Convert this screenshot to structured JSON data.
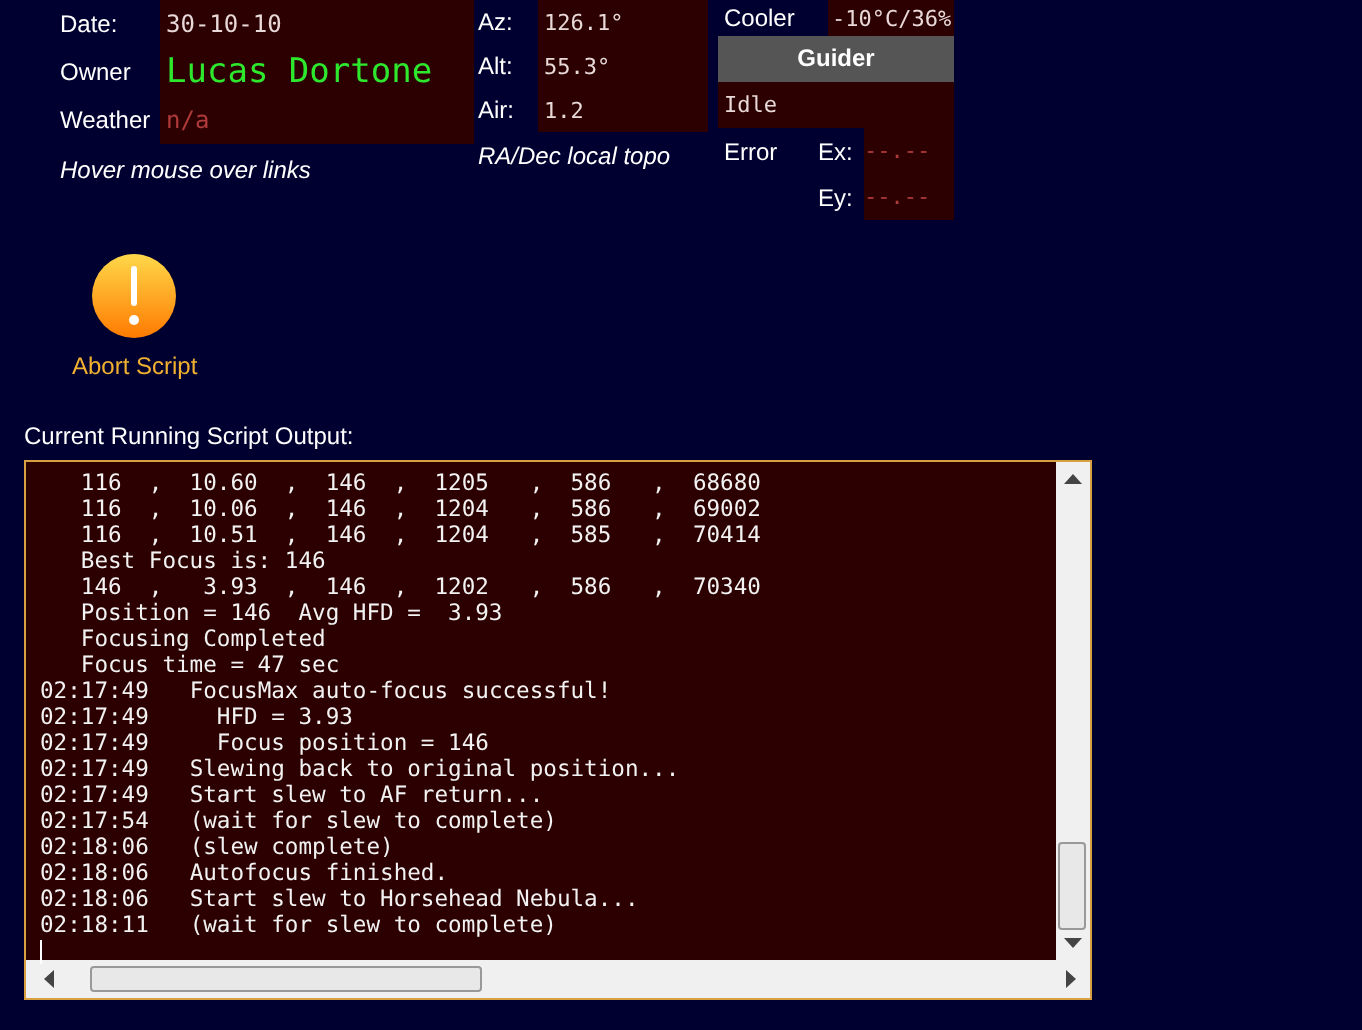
{
  "session": {
    "fields": [
      {
        "label": "Date:",
        "value": "30-10-10",
        "kind": "plain"
      },
      {
        "label": "Owner",
        "value": "Lucas Dortone",
        "kind": "highlight"
      },
      {
        "label": "Weather",
        "value": "n/a",
        "kind": "dim"
      }
    ],
    "hint": "Hover mouse over links"
  },
  "mount": {
    "fields": [
      {
        "label": "Az:",
        "value": "126.1°"
      },
      {
        "label": "Alt:",
        "value": "55.3°"
      },
      {
        "label": "Air:",
        "value": "1.2"
      }
    ],
    "note": "RA/Dec local topo"
  },
  "camera": {
    "cooler_label": "Cooler",
    "cooler_value": "-10°C/36%",
    "guider_title": "Guider",
    "guider_status": "Idle",
    "error_label": "Error",
    "errors": [
      {
        "label": "Ex:",
        "value": "--.--"
      },
      {
        "label": "Ey:",
        "value": "--.--"
      }
    ]
  },
  "abort_button": {
    "label": "Abort Script"
  },
  "output": {
    "title": "Current Running Script Output:",
    "lines": [
      {
        "kind": "detail",
        "text": "116  ,  10.60  ,  146  ,  1205   ,  586   ,  68680"
      },
      {
        "kind": "detail",
        "text": "116  ,  10.06  ,  146  ,  1204   ,  586   ,  69002"
      },
      {
        "kind": "detail",
        "text": "116  ,  10.51  ,  146  ,  1204   ,  585   ,  70414"
      },
      {
        "kind": "detail",
        "text": "Best Focus is: 146"
      },
      {
        "kind": "detail",
        "text": "146  ,   3.93  ,  146  ,  1202   ,  586   ,  70340"
      },
      {
        "kind": "detail",
        "text": "Position = 146  Avg HFD =  3.93"
      },
      {
        "kind": "detail",
        "text": "Focusing Completed"
      },
      {
        "kind": "detail",
        "text": "Focus time = 47 sec"
      },
      {
        "kind": "event",
        "text": "02:17:49   FocusMax auto-focus successful!"
      },
      {
        "kind": "event",
        "text": "02:17:49     HFD = 3.93"
      },
      {
        "kind": "event",
        "text": "02:17:49     Focus position = 146"
      },
      {
        "kind": "event",
        "text": "02:17:49   Slewing back to original position..."
      },
      {
        "kind": "event",
        "text": "02:17:49   Start slew to AF return..."
      },
      {
        "kind": "event",
        "text": "02:17:54   (wait for slew to complete)"
      },
      {
        "kind": "event",
        "text": "02:18:06   (slew complete)"
      },
      {
        "kind": "event",
        "text": "02:18:06   Autofocus finished."
      },
      {
        "kind": "event",
        "text": "02:18:06   Start slew to Horsehead Nebula..."
      },
      {
        "kind": "event",
        "text": "02:18:11   (wait for slew to complete)"
      }
    ]
  }
}
